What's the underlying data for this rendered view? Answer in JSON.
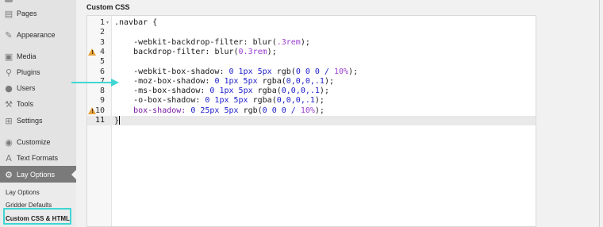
{
  "sidebar": {
    "items": [
      {
        "label": "Pages",
        "icon": "pages-icon",
        "glyph": "▤"
      },
      {
        "label": "Appearance",
        "icon": "appearance-icon",
        "glyph": "✎"
      },
      {
        "label": "Media",
        "icon": "media-icon",
        "glyph": "▣"
      },
      {
        "label": "Plugins",
        "icon": "plugins-icon",
        "glyph": "⚲"
      },
      {
        "label": "Users",
        "icon": "users-icon",
        "glyph": "●"
      },
      {
        "label": "Tools",
        "icon": "tools-icon",
        "glyph": "⚒"
      },
      {
        "label": "Settings",
        "icon": "settings-icon",
        "glyph": "⊞"
      },
      {
        "label": "Customize",
        "icon": "customize-icon",
        "glyph": "◉"
      },
      {
        "label": "Text Formats",
        "icon": "text-formats-icon",
        "glyph": "A"
      },
      {
        "label": "Lay Options",
        "icon": "gear-icon",
        "glyph": "⚙",
        "active": true
      }
    ],
    "submenu": [
      {
        "label": "Lay Options"
      },
      {
        "label": "Gridder Defaults"
      },
      {
        "label": "Custom CSS & HTML",
        "current": true
      }
    ]
  },
  "header": {
    "title": "Custom CSS"
  },
  "editor": {
    "lines": [
      {
        "num": "1",
        "fold": true,
        "tokens": [
          [
            ".navbar {",
            "p"
          ]
        ]
      },
      {
        "num": "2",
        "tokens": []
      },
      {
        "num": "3",
        "tokens": [
          [
            "    -webkit-backdrop-filter: ",
            "p"
          ],
          [
            "blur(",
            "p"
          ],
          [
            ".3rem",
            "v"
          ],
          [
            ");",
            "p"
          ]
        ]
      },
      {
        "num": "4",
        "warn": true,
        "tokens": [
          [
            "    backdrop-filter: ",
            "p"
          ],
          [
            "blur(",
            "p"
          ],
          [
            "0.3rem",
            "v"
          ],
          [
            ");",
            "p"
          ]
        ]
      },
      {
        "num": "5",
        "tokens": []
      },
      {
        "num": "6",
        "tokens": [
          [
            "    -webkit-box-shadow: ",
            "p"
          ],
          [
            "0 1px 5px ",
            "n"
          ],
          [
            "rgb(",
            "p"
          ],
          [
            "0 0 0 / ",
            "n"
          ],
          [
            "10%",
            "v"
          ],
          [
            ");",
            "p"
          ]
        ]
      },
      {
        "num": "7",
        "tokens": [
          [
            "    -moz-box-shadow: ",
            "p"
          ],
          [
            "0 1px 5px ",
            "n"
          ],
          [
            "rgba(",
            "p"
          ],
          [
            "0,0,0,.1",
            "n"
          ],
          [
            ");",
            "p"
          ]
        ]
      },
      {
        "num": "8",
        "tokens": [
          [
            "    -ms-box-shadow: ",
            "p"
          ],
          [
            "0 1px 5px ",
            "n"
          ],
          [
            "rgba(",
            "p"
          ],
          [
            "0,0,0,.1",
            "n"
          ],
          [
            ");",
            "p"
          ]
        ]
      },
      {
        "num": "9",
        "tokens": [
          [
            "    -o-box-shadow: ",
            "p"
          ],
          [
            "0 1px 5px ",
            "n"
          ],
          [
            "rgba(",
            "p"
          ],
          [
            "0,0,0,.1",
            "n"
          ],
          [
            ");",
            "p"
          ]
        ]
      },
      {
        "num": "10",
        "warn": true,
        "tokens": [
          [
            "    box-shadow: ",
            "k"
          ],
          [
            "0 25px 5px ",
            "n"
          ],
          [
            "rgb(",
            "p"
          ],
          [
            "0 0 0 / ",
            "n"
          ],
          [
            "10%",
            "v"
          ],
          [
            ");",
            "p"
          ]
        ]
      },
      {
        "num": "11",
        "active": true,
        "tokens": [
          [
            "}",
            "p"
          ]
        ]
      }
    ]
  },
  "colors": {
    "accent_box": "#3fd6d4",
    "arrow": "#3fd6d4",
    "warning": "#e6a23c",
    "number": "#1d1dc9",
    "percent": "#9a3fd1",
    "keyword": "#7a1da6"
  }
}
